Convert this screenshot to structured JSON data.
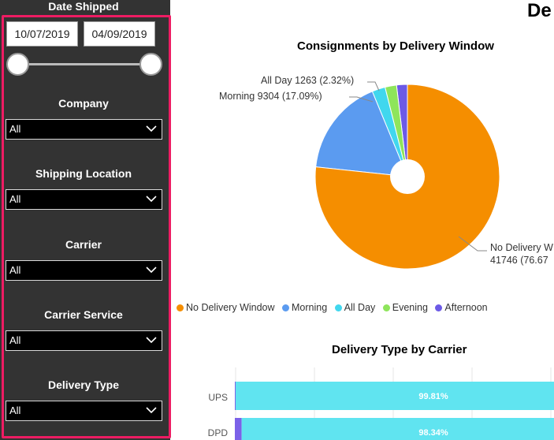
{
  "sidebar": {
    "date_title": "Date Shipped",
    "date_from": "10/07/2019",
    "date_to": "04/09/2019",
    "filters": [
      {
        "title": "Company",
        "value": "All"
      },
      {
        "title": "Shipping Location",
        "value": "All"
      },
      {
        "title": "Carrier",
        "value": "All"
      },
      {
        "title": "Carrier Service",
        "value": "All"
      },
      {
        "title": "Delivery Type",
        "value": "All"
      }
    ],
    "highlight_color": "#ee1c63"
  },
  "header": {
    "title_fragment": "De"
  },
  "pie_labels": {
    "allday": "All Day 1263 (2.32%)",
    "morning": "Morning 9304 (17.09%)",
    "nodelivery_line1": "No Delivery W",
    "nodelivery_line2": "41746 (76.67"
  },
  "bar_labels": {
    "ups_pct": "99.81%",
    "dpd_pct": "98.34%"
  },
  "chart_data": [
    {
      "type": "pie",
      "title": "Consignments by Delivery Window",
      "categories": [
        "No Delivery Window",
        "Morning",
        "All Day",
        "Evening",
        "Afternoon"
      ],
      "values": [
        41746,
        9304,
        1263,
        1100,
        1030
      ],
      "percentages": [
        76.67,
        17.09,
        2.32,
        2.02,
        1.89
      ],
      "colors": [
        "#f58e00",
        "#5b9bf0",
        "#41d7ee",
        "#8ee55b",
        "#6c5ae6"
      ],
      "legend": "bottom"
    },
    {
      "type": "bar",
      "title": "Delivery Type by Carrier",
      "orientation": "horizontal",
      "stacked": true,
      "categories": [
        "UPS",
        "DPD"
      ],
      "series": [
        {
          "values": [
            0.19,
            1.66
          ],
          "color": "#7b61e8"
        },
        {
          "values": [
            99.81,
            98.34
          ],
          "color": "#60e4f0"
        }
      ],
      "xlim": [
        0,
        100
      ],
      "grid": true
    }
  ]
}
